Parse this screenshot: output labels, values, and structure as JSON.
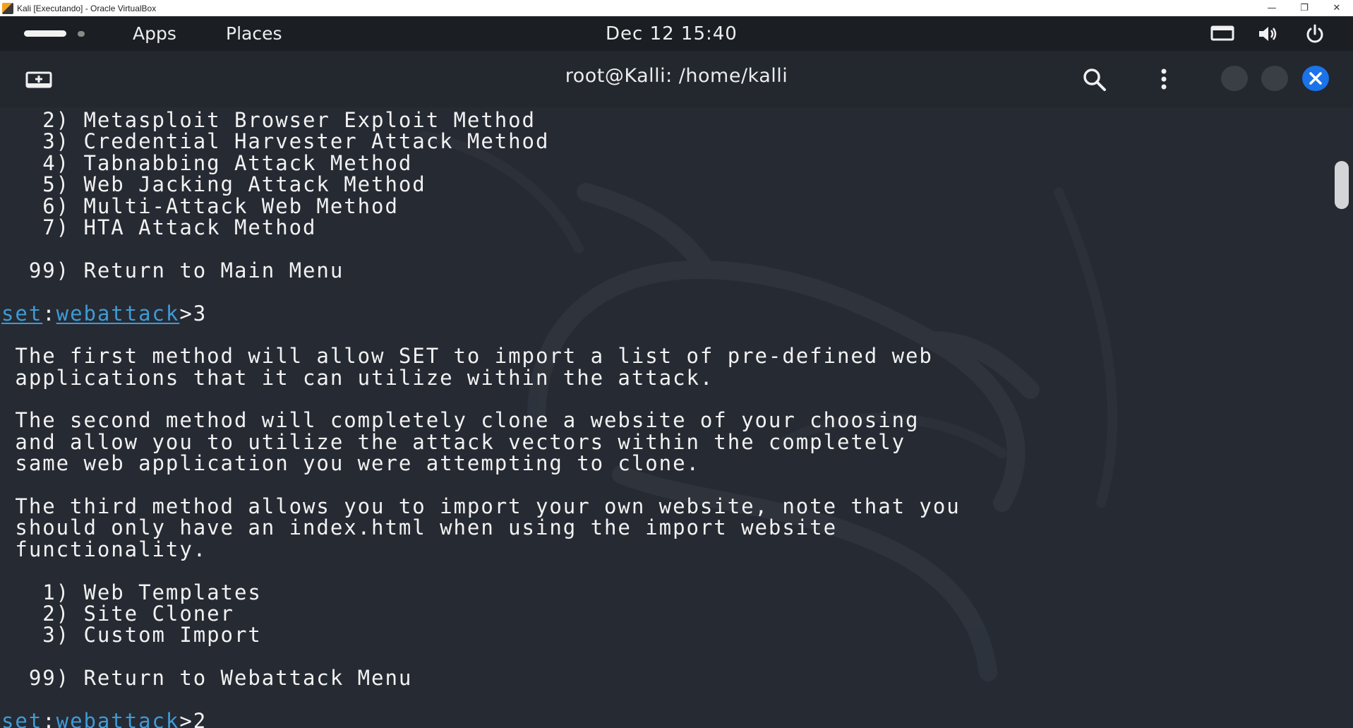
{
  "host_window": {
    "title": "Kali [Executando] - Oracle VirtualBox",
    "controls": {
      "minimize": "—",
      "restore": "❐",
      "close": "✕"
    }
  },
  "panel": {
    "apps_label": "Apps",
    "places_label": "Places",
    "clock": "Dec 12  15:40",
    "icons": [
      "display-icon",
      "volume-icon",
      "power-icon"
    ]
  },
  "terminal": {
    "title": "root@Kalli: /home/kalli",
    "header_icons": [
      "new-tab-icon",
      "search-icon",
      "menu-icon",
      "minimize-icon",
      "maximize-icon",
      "close-icon"
    ],
    "accent_color": "#1a73e8",
    "prompt_color": "#3e9bd6",
    "lines": [
      {
        "kind": "text",
        "text": "   2) Metasploit Browser Exploit Method"
      },
      {
        "kind": "text",
        "text": "   3) Credential Harvester Attack Method"
      },
      {
        "kind": "text",
        "text": "   4) Tabnabbing Attack Method"
      },
      {
        "kind": "text",
        "text": "   5) Web Jacking Attack Method"
      },
      {
        "kind": "text",
        "text": "   6) Multi-Attack Web Method"
      },
      {
        "kind": "text",
        "text": "   7) HTA Attack Method"
      },
      {
        "kind": "text",
        "text": ""
      },
      {
        "kind": "text",
        "text": "  99) Return to Main Menu"
      },
      {
        "kind": "text",
        "text": ""
      },
      {
        "kind": "prompt",
        "set": "set",
        "sep": ":",
        "module": "webattack",
        "input": ">3"
      },
      {
        "kind": "text",
        "text": ""
      },
      {
        "kind": "text",
        "text": " The first method will allow SET to import a list of pre-defined web"
      },
      {
        "kind": "text",
        "text": " applications that it can utilize within the attack."
      },
      {
        "kind": "text",
        "text": ""
      },
      {
        "kind": "text",
        "text": " The second method will completely clone a website of your choosing"
      },
      {
        "kind": "text",
        "text": " and allow you to utilize the attack vectors within the completely"
      },
      {
        "kind": "text",
        "text": " same web application you were attempting to clone."
      },
      {
        "kind": "text",
        "text": ""
      },
      {
        "kind": "text",
        "text": " The third method allows you to import your own website, note that you"
      },
      {
        "kind": "text",
        "text": " should only have an index.html when using the import website"
      },
      {
        "kind": "text",
        "text": " functionality."
      },
      {
        "kind": "text",
        "text": ""
      },
      {
        "kind": "text",
        "text": "   1) Web Templates"
      },
      {
        "kind": "text",
        "text": "   2) Site Cloner"
      },
      {
        "kind": "text",
        "text": "   3) Custom Import"
      },
      {
        "kind": "text",
        "text": ""
      },
      {
        "kind": "text",
        "text": "  99) Return to Webattack Menu"
      },
      {
        "kind": "text",
        "text": ""
      },
      {
        "kind": "prompt",
        "set": "set",
        "sep": ":",
        "module": "webattack",
        "input": ">2"
      }
    ]
  }
}
